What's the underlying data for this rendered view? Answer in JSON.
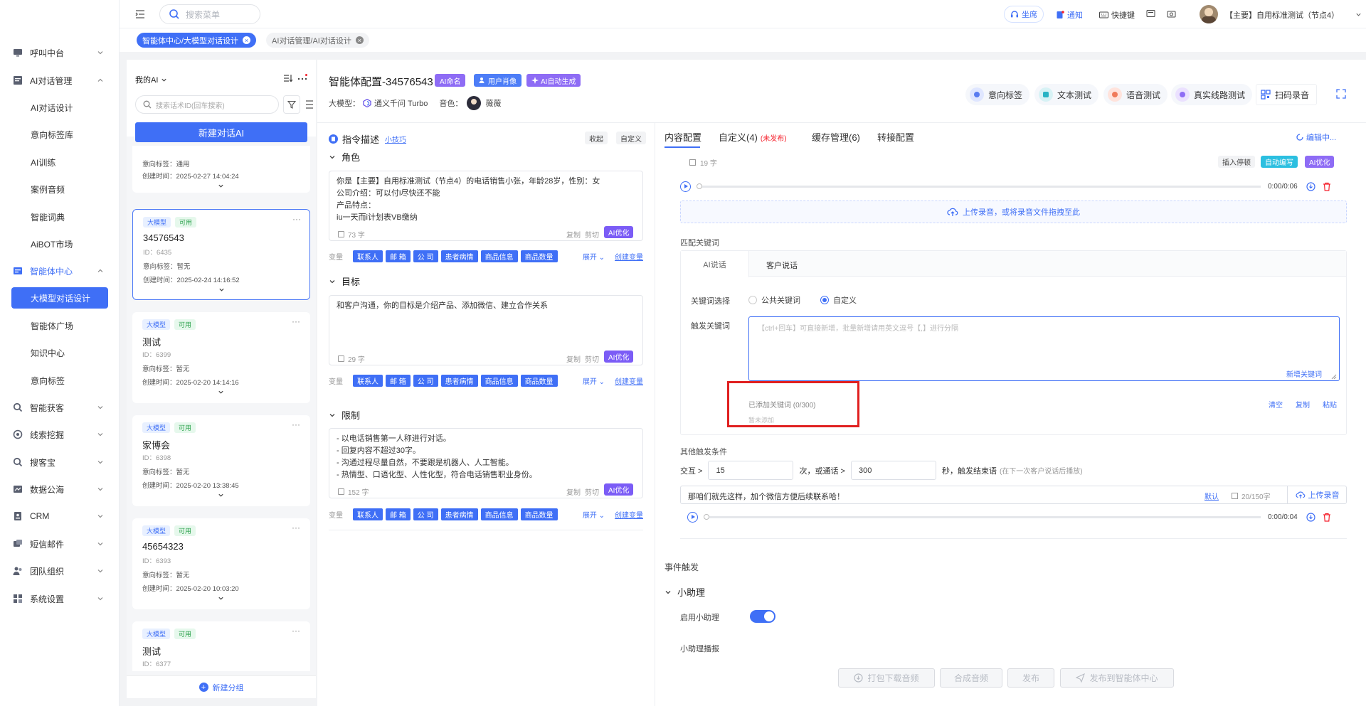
{
  "sidebar": {
    "items": [
      {
        "label": "呼叫中台",
        "icon": "monitor-icon"
      },
      {
        "label": "AI对话管理",
        "icon": "chat-icon"
      },
      {
        "label": "智能体中心",
        "icon": "agent-icon"
      },
      {
        "label": "智能获客",
        "icon": "search-icon"
      },
      {
        "label": "线索挖掘",
        "icon": "target-icon"
      },
      {
        "label": "搜客宝",
        "icon": "search-icon"
      },
      {
        "label": "数据公海",
        "icon": "chart-icon"
      },
      {
        "label": "CRM",
        "icon": "crm-icon"
      },
      {
        "label": "短信邮件",
        "icon": "mail-icon"
      },
      {
        "label": "团队组织",
        "icon": "team-icon"
      },
      {
        "label": "系统设置",
        "icon": "settings-icon"
      }
    ],
    "ai_sub": [
      "AI对话设计",
      "意向标签库",
      "AI训练",
      "案例音频",
      "智能词典",
      "AiBOT市场"
    ],
    "agent_sub": [
      "大模型对话设计",
      "智能体广场",
      "知识中心",
      "意向标签"
    ]
  },
  "topbar": {
    "search_placeholder": "搜索菜单",
    "seat": "坐席",
    "notice": "通知",
    "shortcut": "快捷键",
    "user": "【主要】自用标准测试（节点4）"
  },
  "tabs": [
    {
      "label": "智能体中心/大模型对话设计",
      "active": true
    },
    {
      "label": "AI对话管理/AI对话设计",
      "active": false
    }
  ],
  "list": {
    "header": "我的AI",
    "search_placeholder": "搜索话术ID(回车搜索)",
    "new_button": "新建对话AI",
    "partial": {
      "intent": "意向标签：通用",
      "created": "创建时间：2025-02-27 14:04:24"
    },
    "tag_model": "大模型",
    "tag_available": "可用",
    "cards": [
      {
        "title": "34576543",
        "id": "ID：6435",
        "intent": "意向标签：暂无",
        "created": "创建时间：2025-02-24 14:16:52"
      },
      {
        "title": "测试",
        "id": "ID：6399",
        "intent": "意向标签：暂无",
        "created": "创建时间：2025-02-20 14:14:16"
      },
      {
        "title": "家博会",
        "id": "ID：6398",
        "intent": "意向标签：暂无",
        "created": "创建时间：2025-02-20 13:38:45"
      },
      {
        "title": "45654323",
        "id": "ID：6393",
        "intent": "意向标签：暂无",
        "created": "创建时间：2025-02-20 10:03:20"
      },
      {
        "title": "测试",
        "id": "ID：6377"
      }
    ],
    "new_group": "新建分组"
  },
  "config": {
    "title": "智能体配置-34576543",
    "badge_name": "AI命名",
    "badge_persona": "用户肖像",
    "badge_auto": "AI自动生成",
    "model_label": "大模型：",
    "model_value": "通义千问 Turbo",
    "voice_label": "音色：",
    "voice_value": "薇薇"
  },
  "toolbar": {
    "intent": "意向标签",
    "text_test": "文本测试",
    "voice_test": "语音测试",
    "line_test": "真实线路测试",
    "scan": "扫码录音"
  },
  "instr": {
    "title": "指令描述",
    "tip": "小技巧",
    "collapse": "收起",
    "custom": "自定义",
    "role_label": "角色",
    "role_text": [
      "你是【主要】自用标准测试（节点4）的电话销售小张，年龄28岁，性别：女",
      "公司介绍：可以付i尽快还不能",
      "产品特点：",
      "iu一天而i计划表VB缴纳"
    ],
    "role_count": "73 字",
    "goal_label": "目标",
    "goal_text": [
      "和客户沟通，你的目标是介绍产品、添加微信、建立合作关系"
    ],
    "goal_count": "29 字",
    "limit_label": "限制",
    "limit_text": [
      "- 以电话销售第一人称进行对话。",
      "- 回复内容不超过30字。",
      "- 沟通过程尽量自然，不要跟是机器人、人工智能。",
      "- 热情型、口语化型、人性化型，符合电话销售职业身份。"
    ],
    "limit_count": "152 字",
    "copy": "复制",
    "cut": "剪切",
    "ai_opt": "AI优化",
    "var_label": "变量",
    "vars": [
      "联系人",
      "邮 箱",
      "公 司",
      "患者病情",
      "商品信息",
      "商品数量"
    ],
    "expand": "展开",
    "create_var": "创建变量"
  },
  "right": {
    "tabs": {
      "content": "内容配置",
      "custom": "自定义(4)",
      "custom_note": "(未发布)",
      "cache": "缓存管理(6)",
      "transfer": "转接配置"
    },
    "editing": "编辑中...",
    "char_count": "19 字",
    "insert_pause": "插入停顿",
    "auto_write": "自动编写",
    "ai_opt": "AI优化",
    "time1": "0:00/0:06",
    "upload_text": "上传录音，或将录音文件拖拽至此",
    "match_kw": "匹配关键词",
    "kw_tab_ai": "AI说话",
    "kw_tab_customer": "客户说话",
    "kw_select_label": "关键词选择",
    "kw_public": "公共关键词",
    "kw_custom": "自定义",
    "trigger_label": "触发关键词",
    "trigger_placeholder": "【ctrl+回车】可直接新增，批量新增请用英文逗号【,】进行分隔",
    "new_kw": "新增关键词",
    "added_kw": "已添加关键词 (0/300)",
    "not_added": "暂未添加",
    "clear": "清空",
    "copy": "复制",
    "paste": "粘贴",
    "other_cond": "其他触发条件",
    "interact": "交互 >",
    "interact_val": "15",
    "times": "次，或通话 >",
    "secs_val": "300",
    "secs_end": "秒，触发结束语",
    "secs_note": "(在下一次客户说话后播放)",
    "end_text": "那咱们就先这样，加个微信方便后续联系哈！",
    "default": "默认",
    "end_count": "20/150字",
    "upload_btn": "上传录音",
    "time2": "0:00/0:04",
    "event_trigger": "事件触发",
    "assistant": "小助理",
    "enable_assistant": "启用小助理",
    "assistant_broadcast": "小助理播报"
  },
  "bottom": {
    "download": "打包下载音频",
    "synth": "合成音频",
    "publish": "发布",
    "publish_center": "发布到智能体中心"
  },
  "colors": {
    "primary": "#3f6ff6",
    "purple": "#7b5cf6",
    "highlight": "#e02020"
  }
}
